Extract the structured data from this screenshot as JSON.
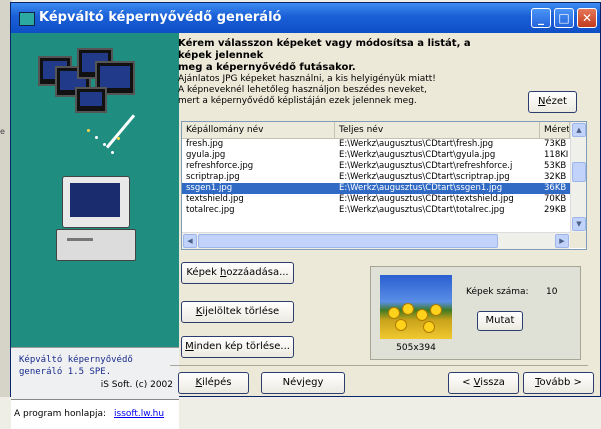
{
  "background": {
    "side_text": "e"
  },
  "window": {
    "title": "Képváltó képernyővédő generáló",
    "controls": {
      "minimize": "_",
      "maximize": "□",
      "close": "✕"
    }
  },
  "sidepanel": {
    "app_name_line1": "Képváltó képernyővédő",
    "app_name_line2": "generáló  1.5 SPE.",
    "copyright": "iS Soft. (c) 2002",
    "homepage_label": "A program honlapja:",
    "homepage_link": "issoft.lw.hu"
  },
  "instructions": {
    "heading_line1": "Kérem válasszon képeket vagy módosítsa a listát, a képek jelennek",
    "heading_line2": "meg a képernyővédő futásakor.",
    "line1": "Ajánlatos JPG képeket használni, a kis helyigényük miatt!",
    "line2": "A képneveknél lehetőleg használjon beszédes neveket,",
    "line3": "mert a képernyővédő képlistáján ezek jelennek meg."
  },
  "buttons": {
    "view": {
      "pre": "",
      "u": "N",
      "post": "ézet"
    },
    "add_images": {
      "pre": "Képek ",
      "u": "h",
      "post": "ozzáadása..."
    },
    "delete_selected": {
      "pre": "",
      "u": "K",
      "post": "ijelöltek törlése"
    },
    "delete_all": {
      "pre": "",
      "u": "M",
      "post": "inden kép törlése..."
    },
    "show": "Mutat",
    "exit": {
      "pre": "",
      "u": "K",
      "post": "ilépés"
    },
    "about": "Névjegy",
    "back": {
      "pre": "< ",
      "u": "V",
      "post": "issza"
    },
    "next": {
      "pre": "",
      "u": "T",
      "post": "ovább >"
    }
  },
  "table": {
    "columns": [
      "Képállomány név",
      "Teljes név",
      "Méret"
    ],
    "rows": [
      {
        "name": "fresh.jpg",
        "path": "E:\\Werkz\\augusztus\\CDtart\\fresh.jpg",
        "size": "73KB"
      },
      {
        "name": "gyula.jpg",
        "path": "E:\\Werkz\\augusztus\\CDtart\\gyula.jpg",
        "size": "118KI"
      },
      {
        "name": "refreshforce.jpg",
        "path": "E:\\Werkz\\augusztus\\CDtart\\refreshforce.j",
        "size": "53KB"
      },
      {
        "name": "scriptrap.jpg",
        "path": "E:\\Werkz\\augusztus\\CDtart\\scriptrap.jpg",
        "size": "32KB"
      },
      {
        "name": "ssgen1.jpg",
        "path": "E:\\Werkz\\augusztus\\CDtart\\ssgen1.jpg",
        "size": "36KB"
      },
      {
        "name": "textshield.jpg",
        "path": "E:\\Werkz\\augusztus\\CDtart\\textshield.jpg",
        "size": "70KB"
      },
      {
        "name": "totalrec.jpg",
        "path": "E:\\Werkz\\augusztus\\CDtart\\totalrec.jpg",
        "size": "29KB"
      }
    ],
    "selected_index": 4
  },
  "preview": {
    "dimensions": "505x394",
    "count_label": "Képek száma:",
    "count_value": "10"
  },
  "colors": {
    "titlebar": "#1a5fd6",
    "sidepanel": "#1f8e80",
    "selection": "#316ac5",
    "app_name": "#1a2a8c",
    "link": "#0000ee"
  }
}
